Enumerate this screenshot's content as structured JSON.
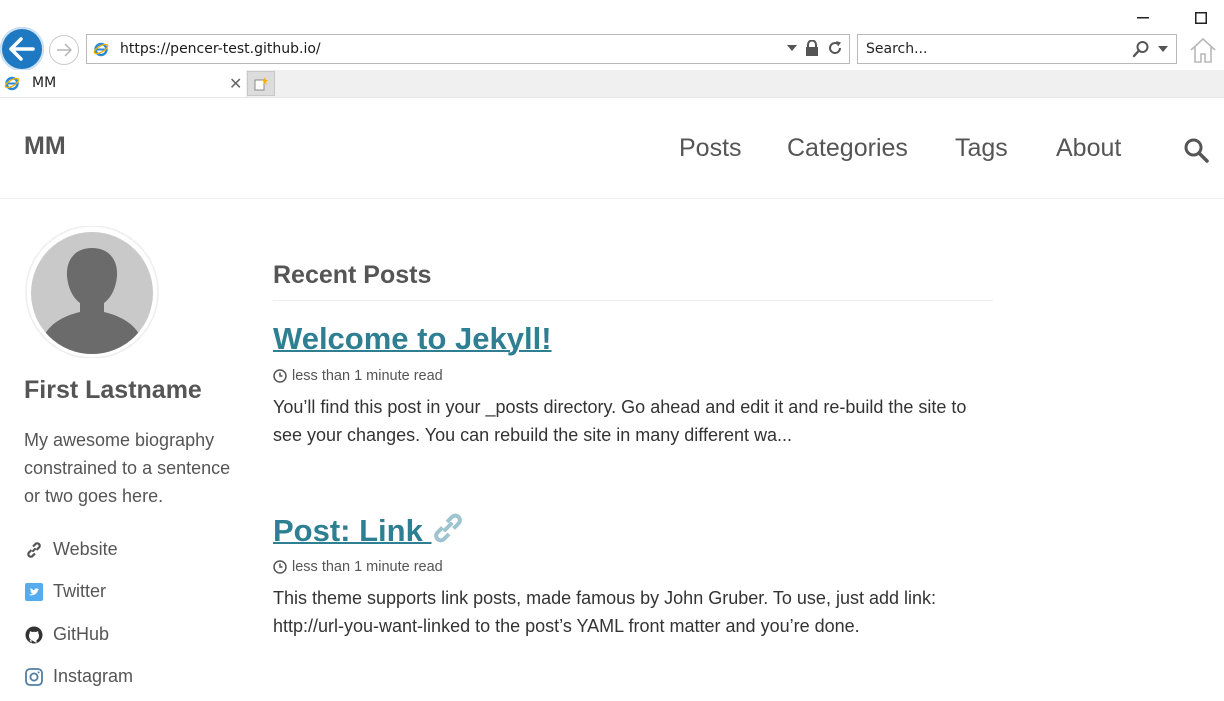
{
  "browser": {
    "url": "https://pencer-test.github.io/",
    "search_placeholder": "Search...",
    "tab_title": "MM"
  },
  "site": {
    "title": "MM",
    "nav": [
      "Posts",
      "Categories",
      "Tags",
      "About"
    ]
  },
  "author": {
    "name": "First Lastname",
    "bio": "My awesome biography constrained to a sentence or two goes here.",
    "links": [
      {
        "label": "Website",
        "icon": "link-icon"
      },
      {
        "label": "Twitter",
        "icon": "twitter-icon"
      },
      {
        "label": "GitHub",
        "icon": "github-icon"
      },
      {
        "label": "Instagram",
        "icon": "instagram-icon"
      }
    ]
  },
  "main": {
    "section_title": "Recent Posts",
    "posts": [
      {
        "title": "Welcome to Jekyll!",
        "meta": "less than 1 minute read",
        "excerpt": "You’ll find this post in your _posts directory. Go ahead and edit it and re-build the site to see your changes. You can rebuild the site in many different wa..."
      },
      {
        "title": "Post: Link ",
        "meta": "less than 1 minute read",
        "excerpt": "This theme supports link posts, made famous by John Gruber. To use, just add link: http://url-you-want-linked to the post’s YAML front matter and you’re done."
      }
    ]
  },
  "colors": {
    "accent": "#2f7f93",
    "text": "#333333",
    "muted": "#555555",
    "ie_blue": "#1e78c2"
  }
}
